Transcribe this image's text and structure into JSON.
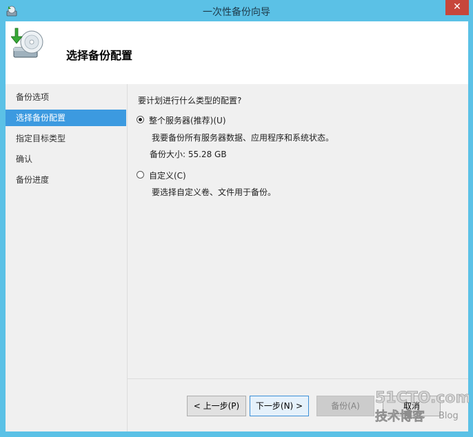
{
  "window": {
    "title": "一次性备份向导",
    "close_label": "✕"
  },
  "header": {
    "title": "选择备份配置",
    "icon": "backup-wizard-icon"
  },
  "steps": [
    {
      "label": "备份选项",
      "active": false
    },
    {
      "label": "选择备份配置",
      "active": true
    },
    {
      "label": "指定目标类型",
      "active": false
    },
    {
      "label": "确认",
      "active": false
    },
    {
      "label": "备份进度",
      "active": false
    }
  ],
  "content": {
    "question": "要计划进行什么类型的配置?",
    "options": [
      {
        "label": "整个服务器(推荐)(U)",
        "selected": true,
        "description": "我要备份所有服务器数据、应用程序和系统状态。",
        "size_text": "备份大小: 55.28 GB"
      },
      {
        "label": "自定义(C)",
        "selected": false,
        "description": "要选择自定义卷、文件用于备份。"
      }
    ]
  },
  "buttons": {
    "previous": "< 上一步(P)",
    "next": "下一步(N) >",
    "backup": "备份(A)",
    "cancel": "取消"
  },
  "watermark": {
    "line1": "51CTO.com",
    "line2": "技术博客",
    "line3": "Blog"
  },
  "colors": {
    "titlebar": "#5bc1e6",
    "active_step": "#3c9ae0",
    "close_button": "#c7463b"
  }
}
